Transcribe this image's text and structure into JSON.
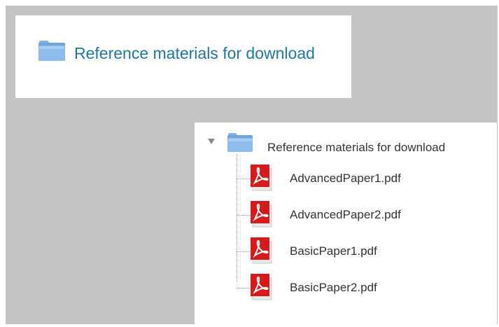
{
  "top_card": {
    "folder_icon": "folder-icon",
    "link_label": "Reference materials for download"
  },
  "tree": {
    "toggle_icon": "triangle-down-icon",
    "folder_icon": "folder-icon",
    "folder_label": "Reference materials for download",
    "files": [
      {
        "name": "AdvancedPaper1.pdf",
        "icon": "pdf-icon"
      },
      {
        "name": "AdvancedPaper2.pdf",
        "icon": "pdf-icon"
      },
      {
        "name": "BasicPaper1.pdf",
        "icon": "pdf-icon"
      },
      {
        "name": "BasicPaper2.pdf",
        "icon": "pdf-icon"
      }
    ]
  },
  "colors": {
    "link": "#1f77a4",
    "folder": "#6fa6e0",
    "pdf_red": "#d9191a",
    "background": "#c4c4c4"
  }
}
